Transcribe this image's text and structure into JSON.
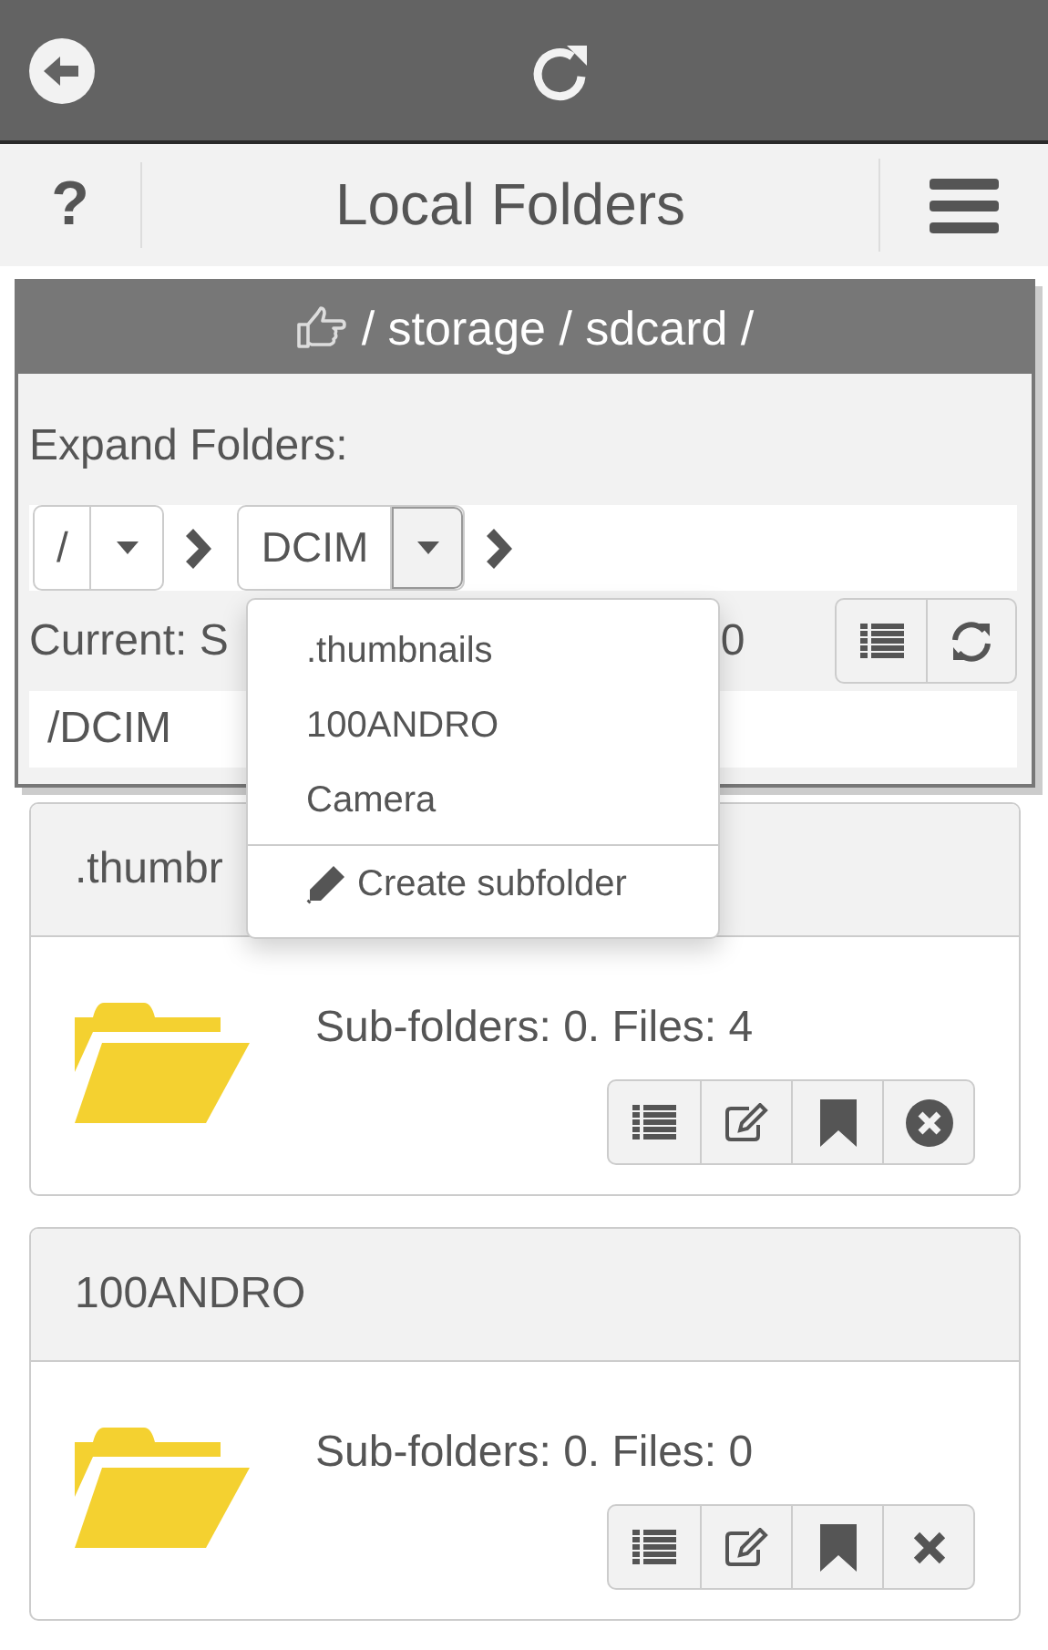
{
  "header": {
    "help": "?",
    "title": "Local Folders"
  },
  "location": {
    "path": "/ storage / sdcard /"
  },
  "expand_label": "Expand Folders:",
  "crumbs": [
    {
      "label": "/",
      "open": false
    },
    {
      "label": "DCIM",
      "open": true
    }
  ],
  "current": {
    "label": "Current: S",
    "tail": "0"
  },
  "path_value": "/DCIM",
  "dropdown": {
    "items": [
      ".thumbnails",
      "100ANDRO",
      "Camera"
    ],
    "action": "Create subfolder"
  },
  "folders": [
    {
      "name": ".thumbr",
      "info": "Sub-folders: 0. Files: 4",
      "kind": "nonempty"
    },
    {
      "name": "100ANDRO",
      "info": "Sub-folders: 0. Files: 0",
      "kind": "empty"
    }
  ]
}
